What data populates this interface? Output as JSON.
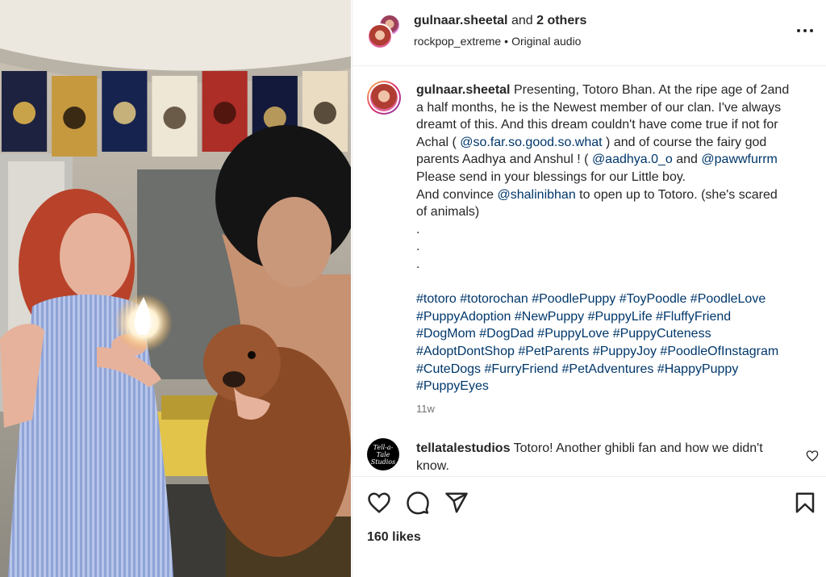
{
  "media": {
    "banners": [
      {
        "color": "#1d2240",
        "emblem": "#c9a34a"
      },
      {
        "color": "#c6993e",
        "emblem": "#3a2a14"
      },
      {
        "color": "#16234f",
        "emblem": "#c7b17a"
      },
      {
        "color": "#efe7d6",
        "emblem": "#6a5a48"
      },
      {
        "color": "#ad2d27",
        "emblem": "#52160f"
      },
      {
        "color": "#13193a",
        "emblem": "#b6985a"
      },
      {
        "color": "#e9dcc3",
        "emblem": "#5a4c3b"
      }
    ]
  },
  "header": {
    "username": "gulnaar.sheetal",
    "and_text": " and ",
    "others_text": "2 others",
    "audio_account": "rockpop_extreme",
    "separator": "•",
    "audio_label": "Original audio"
  },
  "caption": {
    "username": "gulnaar.sheetal",
    "l1": " Presenting, Totoro Bhan. At the ripe age of 2and",
    "l2": "a half months, he is the Newest member of our clan. I've always",
    "l3": "dreamt of this. And this dream couldn't have come true if not for",
    "l4a": "Achal ( ",
    "l4m": "@so.far.so.good.so.what",
    "l4b": " ) and of course the fairy god",
    "l5a": "parents Aadhya and Anshul ! ( ",
    "l5m1": "@aadhya.0_o",
    "l5b": " and ",
    "l5m2": "@pawwfurrm",
    "l6": "Please send in your blessings for our Little boy.",
    "l7a": "And convince ",
    "l7m": "@shalinibhan",
    "l7b": " to open up to Totoro. (she's scared",
    "l8": "of animals)",
    "dot": ".",
    "h1": "#totoro #totorochan #PoodlePuppy #ToyPoodle #PoodleLove",
    "h2": "#PuppyAdoption #NewPuppy #PuppyLife #FluffyFriend",
    "h3": "#DogMom #DogDad #PuppyLove #PuppyCuteness",
    "h4": "#AdoptDontShop #PetParents #PuppyJoy #PoodleOfInstagram",
    "h5": "#CuteDogs #FurryFriend #PetAdventures #HappyPuppy",
    "h6": "#PuppyEyes"
  },
  "timestamp": "11w",
  "comment": {
    "username": "tellatalestudios",
    "text": " Totoro! Another ghibli fan and how we didn't",
    "text2": "know.",
    "avatar_text": "Tell-a-Tale Studios"
  },
  "likes": "160 likes",
  "icons": {
    "like": "heart-icon",
    "comment": "comment-icon",
    "share": "send-icon",
    "save": "bookmark-icon",
    "more": "more-horizontal-icon"
  },
  "colors": {
    "link": "#00376b",
    "muted": "#737373",
    "text": "#262626"
  }
}
